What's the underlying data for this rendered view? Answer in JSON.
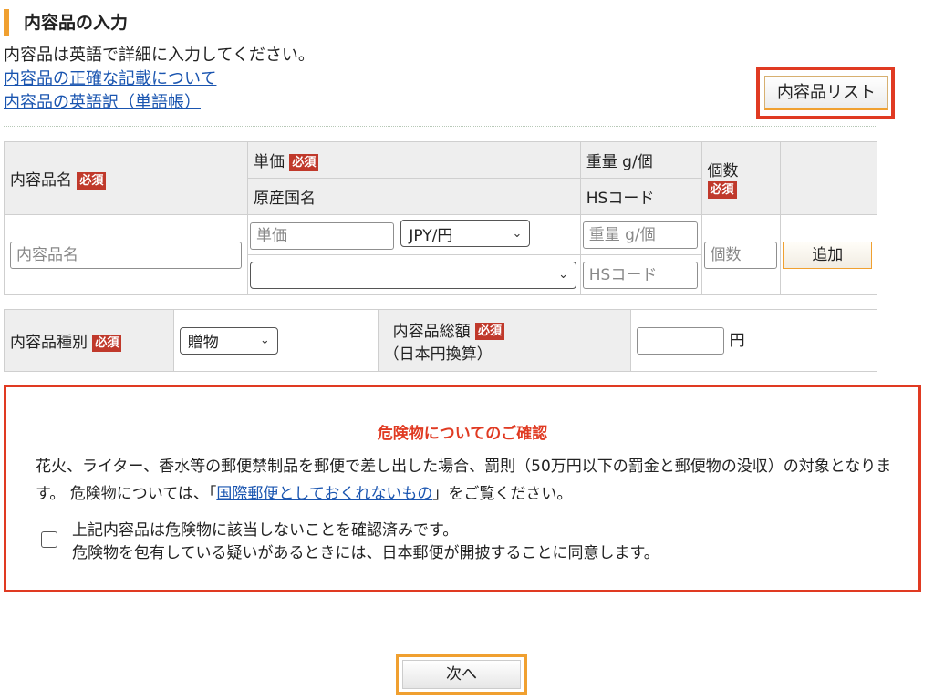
{
  "section": {
    "title": "内容品の入力",
    "instruction": "内容品は英語で詳細に入力してください。",
    "link_accurate": "内容品の正確な記載について",
    "link_glossary": "内容品の英語訳（単語帳）",
    "list_button": "内容品リスト"
  },
  "required_badge": "必須",
  "item_table": {
    "headers": {
      "name": "内容品名",
      "unit_price": "単価",
      "origin": "原産国名",
      "weight": "重量 g/個",
      "hs_code": "HSコード",
      "quantity": "個数"
    },
    "placeholders": {
      "name": "内容品名",
      "unit_price": "単価",
      "weight": "重量 g/個",
      "hs_code": "HSコード",
      "quantity": "個数"
    },
    "currency_selected": "JPY/円",
    "origin_selected": "",
    "add_button": "追加"
  },
  "summary_table": {
    "type_label": "内容品種別",
    "type_selected": "贈物",
    "total_label": "内容品総額",
    "total_sub": "（日本円換算）",
    "total_value": "",
    "total_unit": "円"
  },
  "warning": {
    "title": "危険物についてのご確認",
    "body_1": "花火、ライター、香水等の郵便禁制品を郵便で差し出した場合、罰則（50万円以下の罰金と郵便物の没収）の対象となります。 危険物については、「",
    "link": "国際郵便としておくれないもの",
    "body_2": "」をご覧ください。",
    "confirm_line1": "上記内容品は危険物に該当しないことを確認済みです。",
    "confirm_line2": "危険物を包有している疑いがあるときには、日本郵便が開披することに同意します。"
  },
  "next_button": "次へ",
  "colors": {
    "accent_orange": "#f0a030",
    "alert_red": "#e03a22",
    "required_red": "#c0392b",
    "link_blue": "#1a55b0",
    "header_gray": "#eeeeee"
  },
  "icons": {
    "select_arrow": "chevron-down-icon"
  }
}
